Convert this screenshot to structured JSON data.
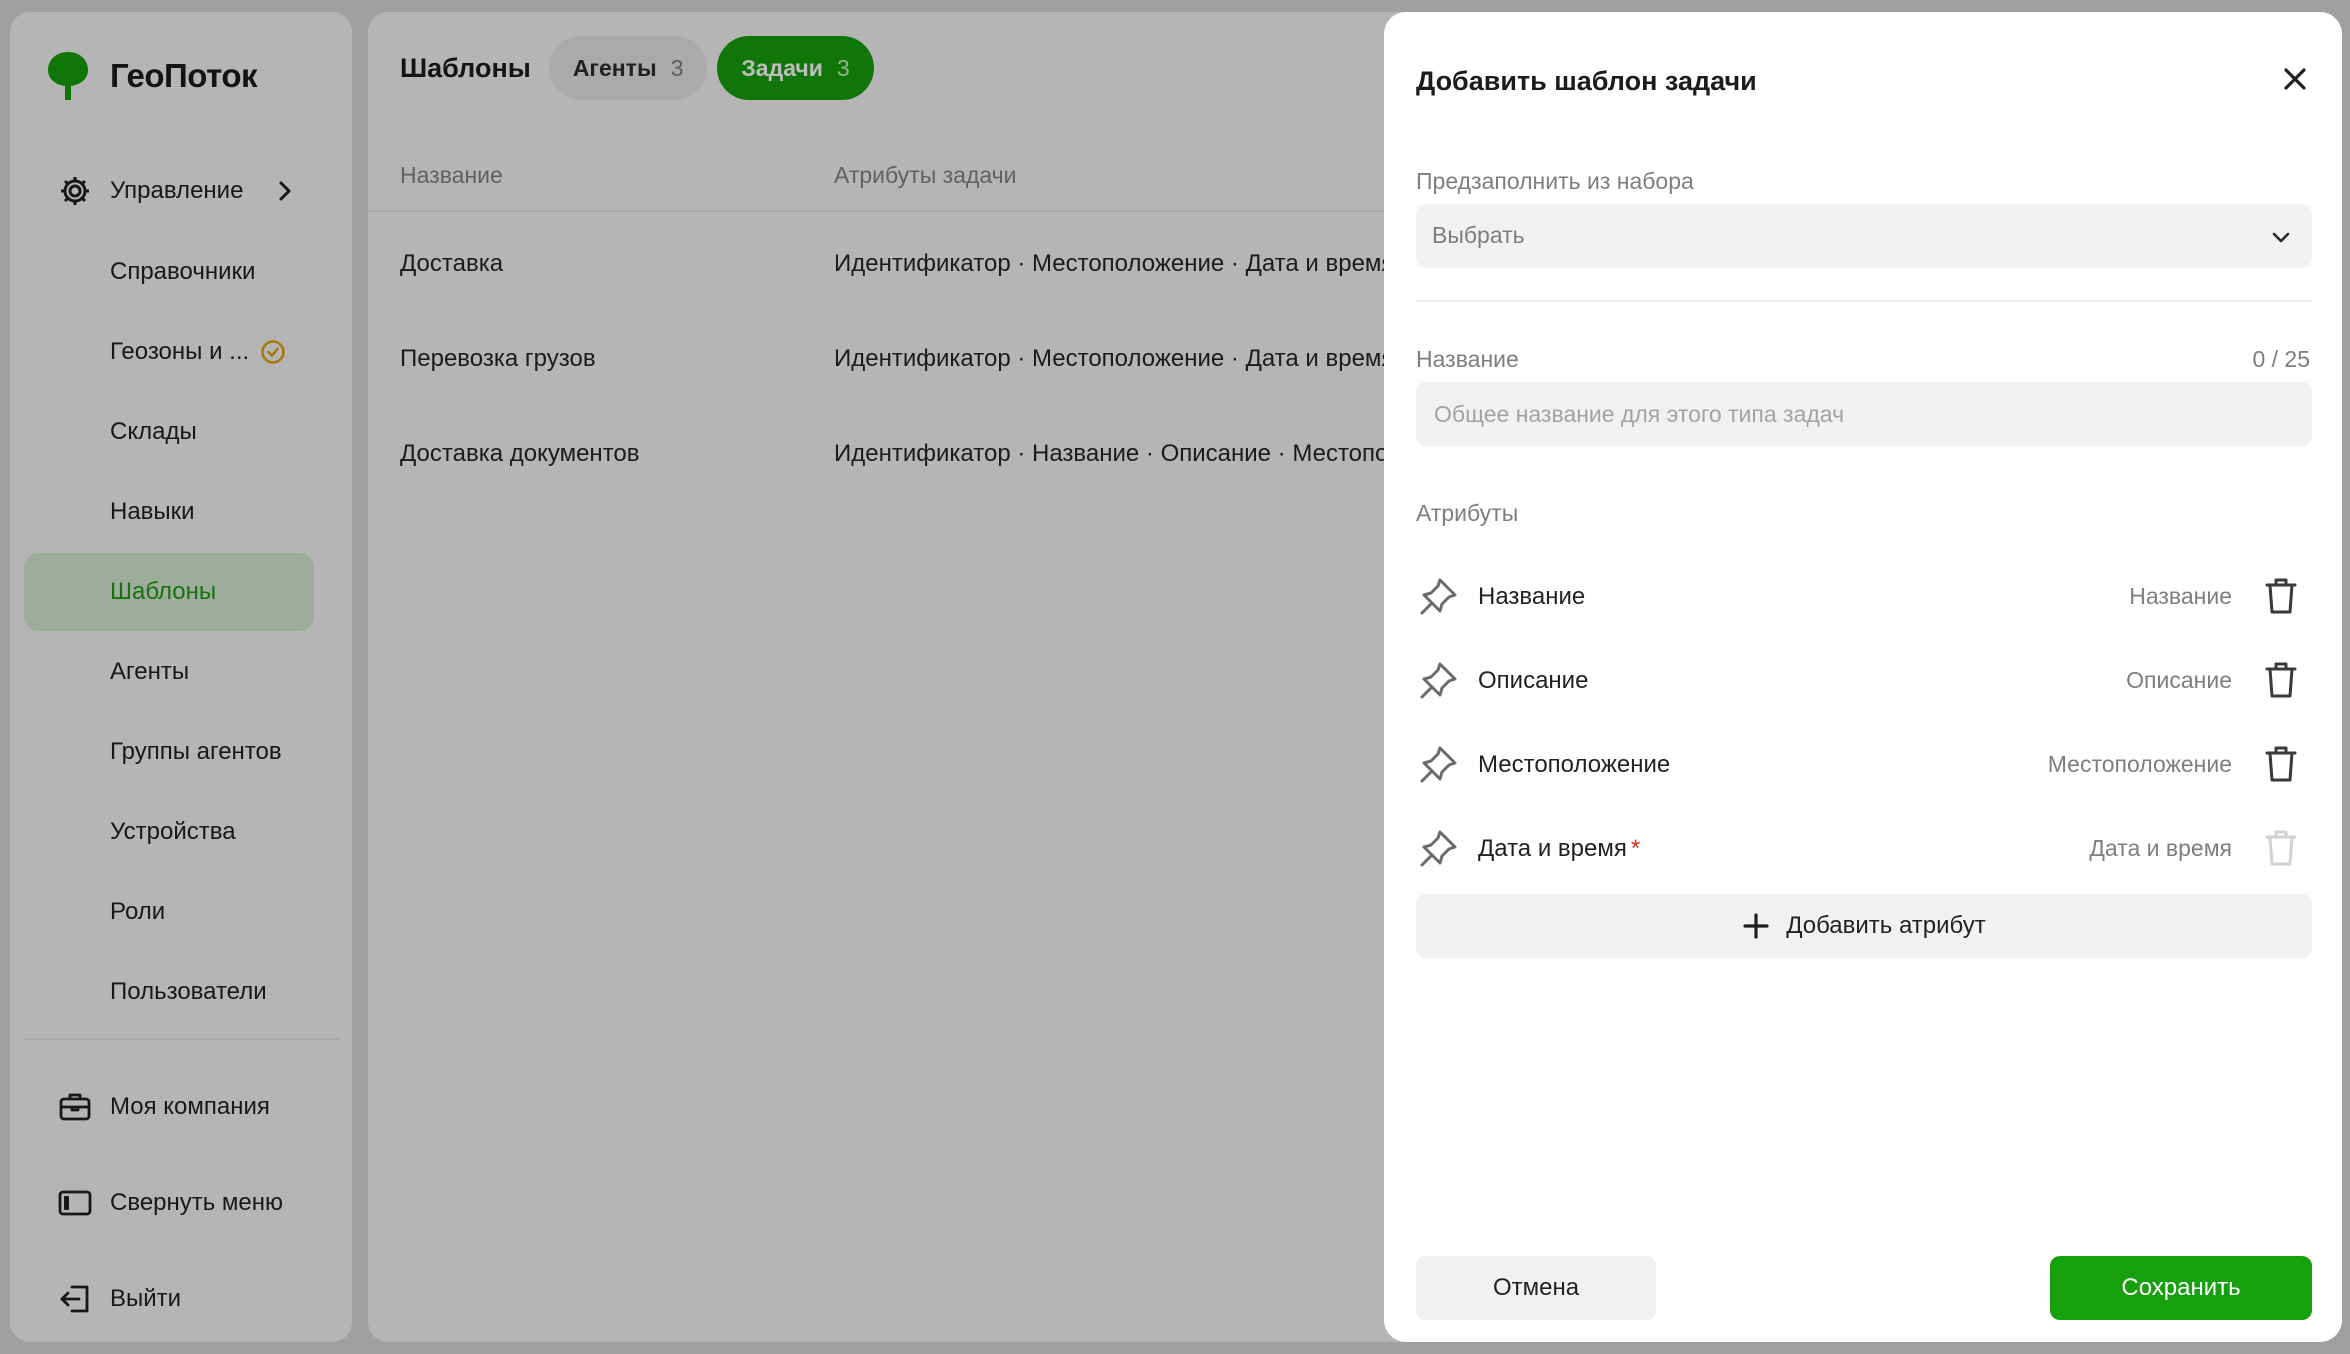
{
  "app": {
    "name": "ГеоПоток",
    "brand_color": "#17a00d"
  },
  "sidebar": {
    "management": {
      "label": "Управление",
      "icon": "gear-icon"
    },
    "items": [
      {
        "label": "Справочники"
      },
      {
        "label": "Геозоны и ...",
        "badge_icon": "clock-warning-icon"
      },
      {
        "label": "Склады"
      },
      {
        "label": "Навыки"
      },
      {
        "label": "Шаблоны",
        "active": true
      },
      {
        "label": "Агенты"
      },
      {
        "label": "Группы агентов"
      },
      {
        "label": "Устройства"
      },
      {
        "label": "Роли"
      },
      {
        "label": "Пользователи"
      }
    ],
    "footer": [
      {
        "label": "Моя компания",
        "icon": "briefcase-icon"
      },
      {
        "label": "Свернуть меню",
        "icon": "collapse-sidebar-icon"
      },
      {
        "label": "Выйти",
        "icon": "logout-icon"
      }
    ]
  },
  "main": {
    "title": "Шаблоны",
    "tabs": [
      {
        "label": "Агенты",
        "count": "3",
        "active": false
      },
      {
        "label": "Задачи",
        "count": "3",
        "active": true
      }
    ],
    "table": {
      "columns": [
        "Название",
        "Атрибуты задачи"
      ],
      "rows": [
        {
          "name": "Доставка",
          "attributes": "Идентификатор · Местоположение · Дата и время"
        },
        {
          "name": "Перевозка грузов",
          "attributes": "Идентификатор · Местоположение · Дата и время"
        },
        {
          "name": "Доставка документов",
          "attributes": "Идентификатор · Название · Описание · Местоположение"
        }
      ]
    }
  },
  "dialog": {
    "title": "Добавить шаблон задачи",
    "prefill": {
      "label": "Предзаполнить из набора",
      "value": "Выбрать"
    },
    "name_field": {
      "label": "Название",
      "counter": "0 / 25",
      "placeholder": "Общее название для этого типа задач",
      "value": ""
    },
    "attributes_label": "Атрибуты",
    "attributes": [
      {
        "name": "Название",
        "type": "Название",
        "required": false,
        "deletable": true
      },
      {
        "name": "Описание",
        "type": "Описание",
        "required": false,
        "deletable": true
      },
      {
        "name": "Местоположение",
        "type": "Местоположение",
        "required": false,
        "deletable": true
      },
      {
        "name": "Дата и время",
        "type": "Дата и время",
        "required": true,
        "required_mark": "*",
        "deletable": false
      }
    ],
    "add_attribute_label": "Добавить атрибут",
    "cancel_label": "Отмена",
    "save_label": "Сохранить"
  }
}
